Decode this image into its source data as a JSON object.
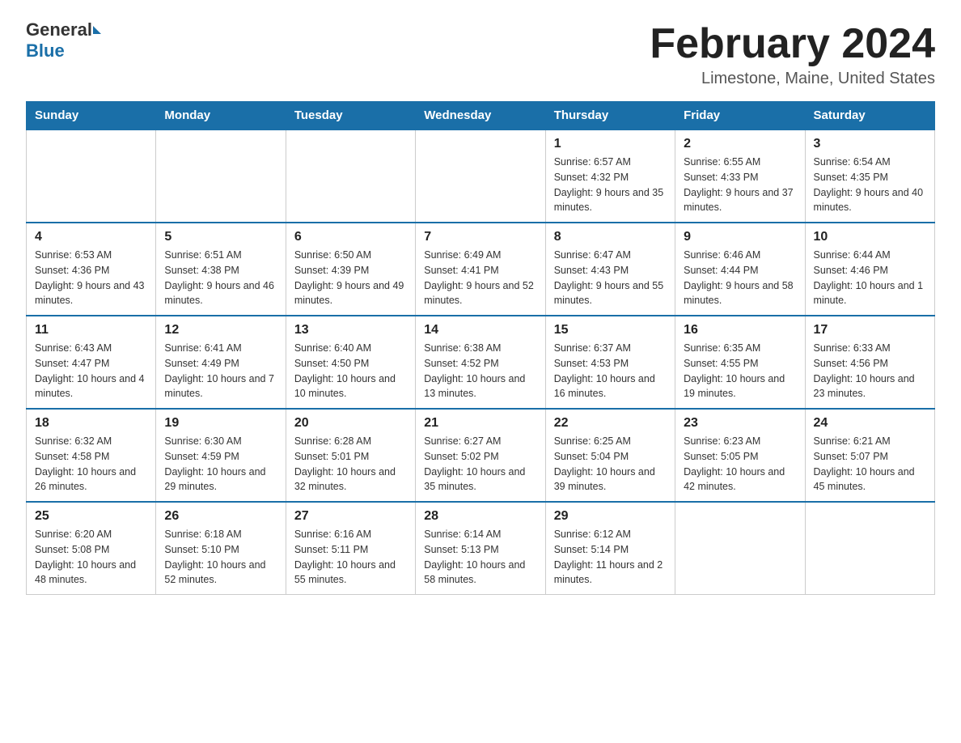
{
  "header": {
    "logo_general": "General",
    "logo_blue": "Blue",
    "title": "February 2024",
    "location": "Limestone, Maine, United States"
  },
  "days_of_week": [
    "Sunday",
    "Monday",
    "Tuesday",
    "Wednesday",
    "Thursday",
    "Friday",
    "Saturday"
  ],
  "weeks": [
    [
      {
        "day": "",
        "info": ""
      },
      {
        "day": "",
        "info": ""
      },
      {
        "day": "",
        "info": ""
      },
      {
        "day": "",
        "info": ""
      },
      {
        "day": "1",
        "info": "Sunrise: 6:57 AM\nSunset: 4:32 PM\nDaylight: 9 hours\nand 35 minutes."
      },
      {
        "day": "2",
        "info": "Sunrise: 6:55 AM\nSunset: 4:33 PM\nDaylight: 9 hours\nand 37 minutes."
      },
      {
        "day": "3",
        "info": "Sunrise: 6:54 AM\nSunset: 4:35 PM\nDaylight: 9 hours\nand 40 minutes."
      }
    ],
    [
      {
        "day": "4",
        "info": "Sunrise: 6:53 AM\nSunset: 4:36 PM\nDaylight: 9 hours\nand 43 minutes."
      },
      {
        "day": "5",
        "info": "Sunrise: 6:51 AM\nSunset: 4:38 PM\nDaylight: 9 hours\nand 46 minutes."
      },
      {
        "day": "6",
        "info": "Sunrise: 6:50 AM\nSunset: 4:39 PM\nDaylight: 9 hours\nand 49 minutes."
      },
      {
        "day": "7",
        "info": "Sunrise: 6:49 AM\nSunset: 4:41 PM\nDaylight: 9 hours\nand 52 minutes."
      },
      {
        "day": "8",
        "info": "Sunrise: 6:47 AM\nSunset: 4:43 PM\nDaylight: 9 hours\nand 55 minutes."
      },
      {
        "day": "9",
        "info": "Sunrise: 6:46 AM\nSunset: 4:44 PM\nDaylight: 9 hours\nand 58 minutes."
      },
      {
        "day": "10",
        "info": "Sunrise: 6:44 AM\nSunset: 4:46 PM\nDaylight: 10 hours\nand 1 minute."
      }
    ],
    [
      {
        "day": "11",
        "info": "Sunrise: 6:43 AM\nSunset: 4:47 PM\nDaylight: 10 hours\nand 4 minutes."
      },
      {
        "day": "12",
        "info": "Sunrise: 6:41 AM\nSunset: 4:49 PM\nDaylight: 10 hours\nand 7 minutes."
      },
      {
        "day": "13",
        "info": "Sunrise: 6:40 AM\nSunset: 4:50 PM\nDaylight: 10 hours\nand 10 minutes."
      },
      {
        "day": "14",
        "info": "Sunrise: 6:38 AM\nSunset: 4:52 PM\nDaylight: 10 hours\nand 13 minutes."
      },
      {
        "day": "15",
        "info": "Sunrise: 6:37 AM\nSunset: 4:53 PM\nDaylight: 10 hours\nand 16 minutes."
      },
      {
        "day": "16",
        "info": "Sunrise: 6:35 AM\nSunset: 4:55 PM\nDaylight: 10 hours\nand 19 minutes."
      },
      {
        "day": "17",
        "info": "Sunrise: 6:33 AM\nSunset: 4:56 PM\nDaylight: 10 hours\nand 23 minutes."
      }
    ],
    [
      {
        "day": "18",
        "info": "Sunrise: 6:32 AM\nSunset: 4:58 PM\nDaylight: 10 hours\nand 26 minutes."
      },
      {
        "day": "19",
        "info": "Sunrise: 6:30 AM\nSunset: 4:59 PM\nDaylight: 10 hours\nand 29 minutes."
      },
      {
        "day": "20",
        "info": "Sunrise: 6:28 AM\nSunset: 5:01 PM\nDaylight: 10 hours\nand 32 minutes."
      },
      {
        "day": "21",
        "info": "Sunrise: 6:27 AM\nSunset: 5:02 PM\nDaylight: 10 hours\nand 35 minutes."
      },
      {
        "day": "22",
        "info": "Sunrise: 6:25 AM\nSunset: 5:04 PM\nDaylight: 10 hours\nand 39 minutes."
      },
      {
        "day": "23",
        "info": "Sunrise: 6:23 AM\nSunset: 5:05 PM\nDaylight: 10 hours\nand 42 minutes."
      },
      {
        "day": "24",
        "info": "Sunrise: 6:21 AM\nSunset: 5:07 PM\nDaylight: 10 hours\nand 45 minutes."
      }
    ],
    [
      {
        "day": "25",
        "info": "Sunrise: 6:20 AM\nSunset: 5:08 PM\nDaylight: 10 hours\nand 48 minutes."
      },
      {
        "day": "26",
        "info": "Sunrise: 6:18 AM\nSunset: 5:10 PM\nDaylight: 10 hours\nand 52 minutes."
      },
      {
        "day": "27",
        "info": "Sunrise: 6:16 AM\nSunset: 5:11 PM\nDaylight: 10 hours\nand 55 minutes."
      },
      {
        "day": "28",
        "info": "Sunrise: 6:14 AM\nSunset: 5:13 PM\nDaylight: 10 hours\nand 58 minutes."
      },
      {
        "day": "29",
        "info": "Sunrise: 6:12 AM\nSunset: 5:14 PM\nDaylight: 11 hours\nand 2 minutes."
      },
      {
        "day": "",
        "info": ""
      },
      {
        "day": "",
        "info": ""
      }
    ]
  ]
}
